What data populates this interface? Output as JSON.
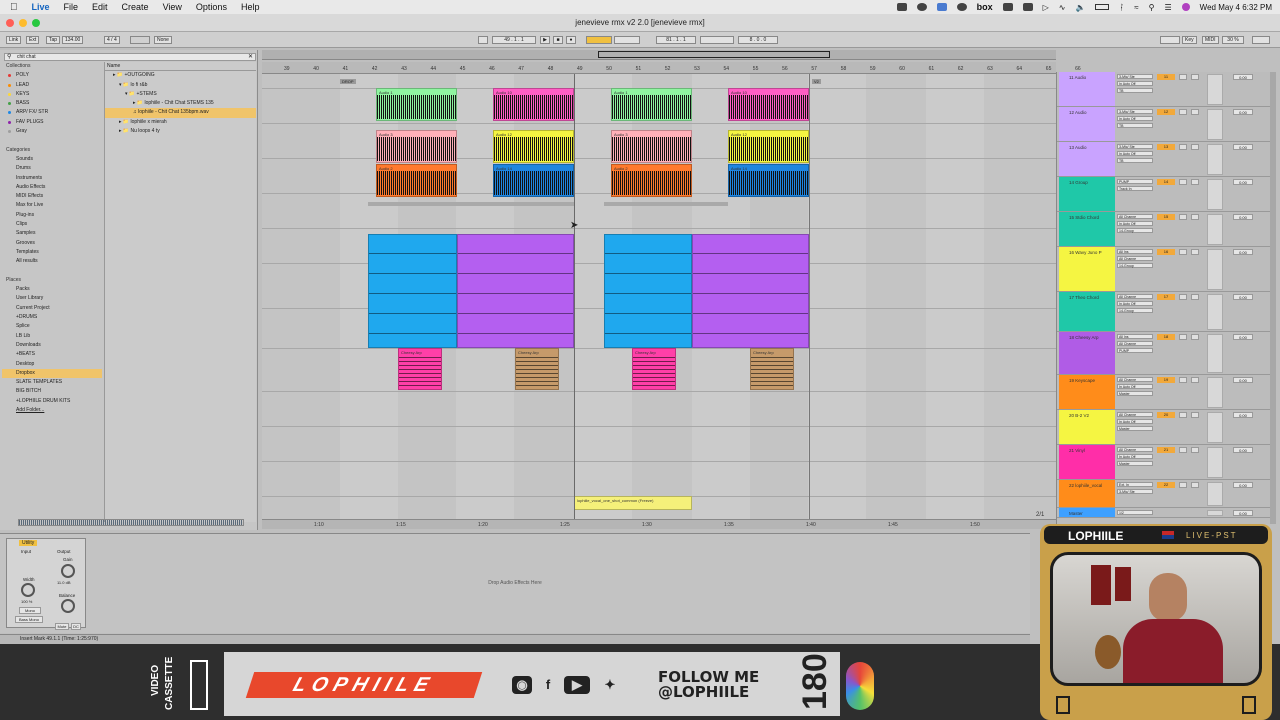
{
  "menubar": {
    "app": "Live",
    "items": [
      "File",
      "Edit",
      "Create",
      "View",
      "Options",
      "Help"
    ],
    "clock": "Wed May 4  6:32 PM",
    "box_label": "box"
  },
  "window": {
    "title": "jenevieve rmx v2 2.0  [jenevieve rmx]"
  },
  "control_bar": {
    "link": "Link",
    "ext": "Ext",
    "tap": "Tap",
    "tempo": "134.00",
    "signature": "4 / 4",
    "quantize": "None",
    "position": "49 . 1 . 1",
    "loop_start": "81 . 1 . 1",
    "loop_length": "8 . 0 . 0",
    "key": "Key",
    "midi": "MIDI",
    "cpu": "30 %"
  },
  "browser": {
    "search": "chit chat",
    "collections_header": "Collections",
    "collections": [
      {
        "label": "POLY",
        "color": "#e53935"
      },
      {
        "label": "LEAD",
        "color": "#fb8c00"
      },
      {
        "label": "KEYS",
        "color": "#fdd835"
      },
      {
        "label": "BASS",
        "color": "#43a047"
      },
      {
        "label": "ARP/ FX/ STR",
        "color": "#1e88e5"
      },
      {
        "label": "FAV PLUGS",
        "color": "#8e24aa"
      },
      {
        "label": "Gray",
        "color": "#9e9e9e"
      }
    ],
    "categories_header": "Categories",
    "categories": [
      "Sounds",
      "Drums",
      "Instruments",
      "Audio Effects",
      "MIDI Effects",
      "Max for Live",
      "Plug-ins",
      "Clips",
      "Samples",
      "Grooves",
      "Templates",
      "All results"
    ],
    "places_header": "Places",
    "places": [
      "Packs",
      "User Library",
      "Current Project",
      "+DRUMS",
      "Splice",
      "LB Lib",
      "Downloads",
      "+BEATS",
      "Desktop",
      "Dropbox",
      "SLATE TEMPLATES",
      "BIG BITCH",
      "+LOPHIILE DRUM KITS",
      "Add Folder..."
    ],
    "selected_place": "Dropbox",
    "name_header": "Name",
    "files": [
      "+OUTGOING",
      "lo fi r&b",
      "+STEMS",
      "lophiile - Chit Chat STEMS 135",
      "lophiile - Chit Chat 135bpm.wav",
      "lophiile x mierah",
      "Nu loops 4 ty"
    ],
    "selected_file": "lophiile - Chit Chat 135bpm.wav"
  },
  "arrangement": {
    "bars": [
      "39",
      "40",
      "41",
      "42",
      "43",
      "44",
      "45",
      "46",
      "47",
      "48",
      "49",
      "50",
      "51",
      "52",
      "53",
      "54",
      "55",
      "56",
      "57",
      "58",
      "59",
      "60",
      "61",
      "62",
      "63",
      "64",
      "65",
      "66"
    ],
    "locators": [
      "DROP",
      "V2"
    ],
    "time_ticks": [
      "1:10",
      "1:15",
      "1:20",
      "1:25",
      "1:30",
      "1:35",
      "1:40",
      "1:45",
      "1:50"
    ],
    "zoom": "2/1",
    "clips": {
      "audio11": [
        "Audio 1",
        "Audio 10",
        "Audio 1",
        "Audio 10"
      ],
      "audio12": [
        "Audio 3",
        "Audio 12",
        "Audio 3",
        "Audio 12"
      ],
      "audio13": [
        "Audio 2",
        "Audio 14",
        "Audio 2",
        "Audio 14"
      ],
      "arp": [
        "Cheesy Arp",
        "Cheesy Arp",
        "Cheesy Arp",
        "Cheesy Arp"
      ],
      "vocal": "lophiile_vocal_one_shot_common (Freeze)"
    }
  },
  "mixer": {
    "tracks": [
      {
        "name": "11 Audio",
        "color": "#c9a3ff",
        "num": "11",
        "io1": "3-Mic/ Ste",
        "io2": "In Auto Off",
        "io3": "TB",
        "vol": "0.00"
      },
      {
        "name": "12 Audio",
        "color": "#c9a3ff",
        "num": "12",
        "io1": "3-Mic/ Ste",
        "io2": "In Auto Off",
        "io3": "TB",
        "vol": "0.00"
      },
      {
        "name": "13 Audio",
        "color": "#c9a3ff",
        "num": "13",
        "io1": "3-Mic/ Ste",
        "io2": "In Auto Off",
        "io3": "TB",
        "vol": "0.00"
      },
      {
        "name": "14 Group",
        "color": "#1fc8a8",
        "num": "14",
        "io1": "PUMP",
        "io2": "Track In",
        "io3": "",
        "vol": "0.00"
      },
      {
        "name": "15 Stdio Chord",
        "color": "#1fc8a8",
        "num": "15",
        "io1": "All Channe",
        "io2": "In Auto Off",
        "io3": "14-Group",
        "vol": "0.00"
      },
      {
        "name": "16 Wavy Juno P",
        "color": "#f5f542",
        "num": "16",
        "io1": "All Ins",
        "io2": "All Channe",
        "io3": "14-Group",
        "vol": "0.00"
      },
      {
        "name": "17 Theo Chord",
        "color": "#1fc8a8",
        "num": "17",
        "io1": "All Channe",
        "io2": "In Auto Off",
        "io3": "14-Group",
        "vol": "0.00"
      },
      {
        "name": "18 Cheesy Arp",
        "color": "#b05ce6",
        "num": "18",
        "io1": "All Ins",
        "io2": "All Channe",
        "io3": "PUMP",
        "vol": "0.00"
      },
      {
        "name": "19 Keyscape",
        "color": "#ff8c1a",
        "num": "19",
        "io1": "All Channe",
        "io2": "In Auto Off",
        "io3": "Master",
        "vol": "0.00"
      },
      {
        "name": "20 B-2 V2",
        "color": "#f5f542",
        "num": "20",
        "io1": "All Channe",
        "io2": "In Auto Off",
        "io3": "Master",
        "vol": "0.00"
      },
      {
        "name": "21 Vinyl",
        "color": "#ff2ea8",
        "num": "21",
        "io1": "All Channe",
        "io2": "In Auto Off",
        "io3": "Master",
        "vol": "0.00"
      },
      {
        "name": "22 lophiile_vocal",
        "color": "#ff8c1a",
        "num": "22",
        "io1": "Ext. In",
        "io2": "3-Mic/ Ste",
        "io3": "",
        "vol": "0.00"
      },
      {
        "name": "Master",
        "color": "#3ea0ff",
        "num": "",
        "io1": "1/2",
        "io2": "",
        "io3": "",
        "vol": "0.00"
      }
    ]
  },
  "device": {
    "name": "Utility",
    "input": "Input",
    "output": "Output",
    "gain": "Gain",
    "gain_val": "11.0 dB",
    "width": "Width",
    "width_val": "100 %",
    "mono": "Mono",
    "bass_mono": "Bass Mono",
    "balance": "Balance",
    "mute": "Mute",
    "dc": "DC",
    "drop_hint": "Drop Audio Effects Here"
  },
  "status": "Insert Mark 49.1.1 (Time: 1:25:970)",
  "overlay": {
    "cassette_top": "VIDEO",
    "cassette_bottom": "CASSETTE",
    "logo": "LOPHIILE",
    "follow_line1": "FOLLOW ME",
    "follow_line2": "@LOPHIILE",
    "number": "180",
    "cam_name": "LOPHIILE",
    "cam_status": "LIVE-PST"
  }
}
